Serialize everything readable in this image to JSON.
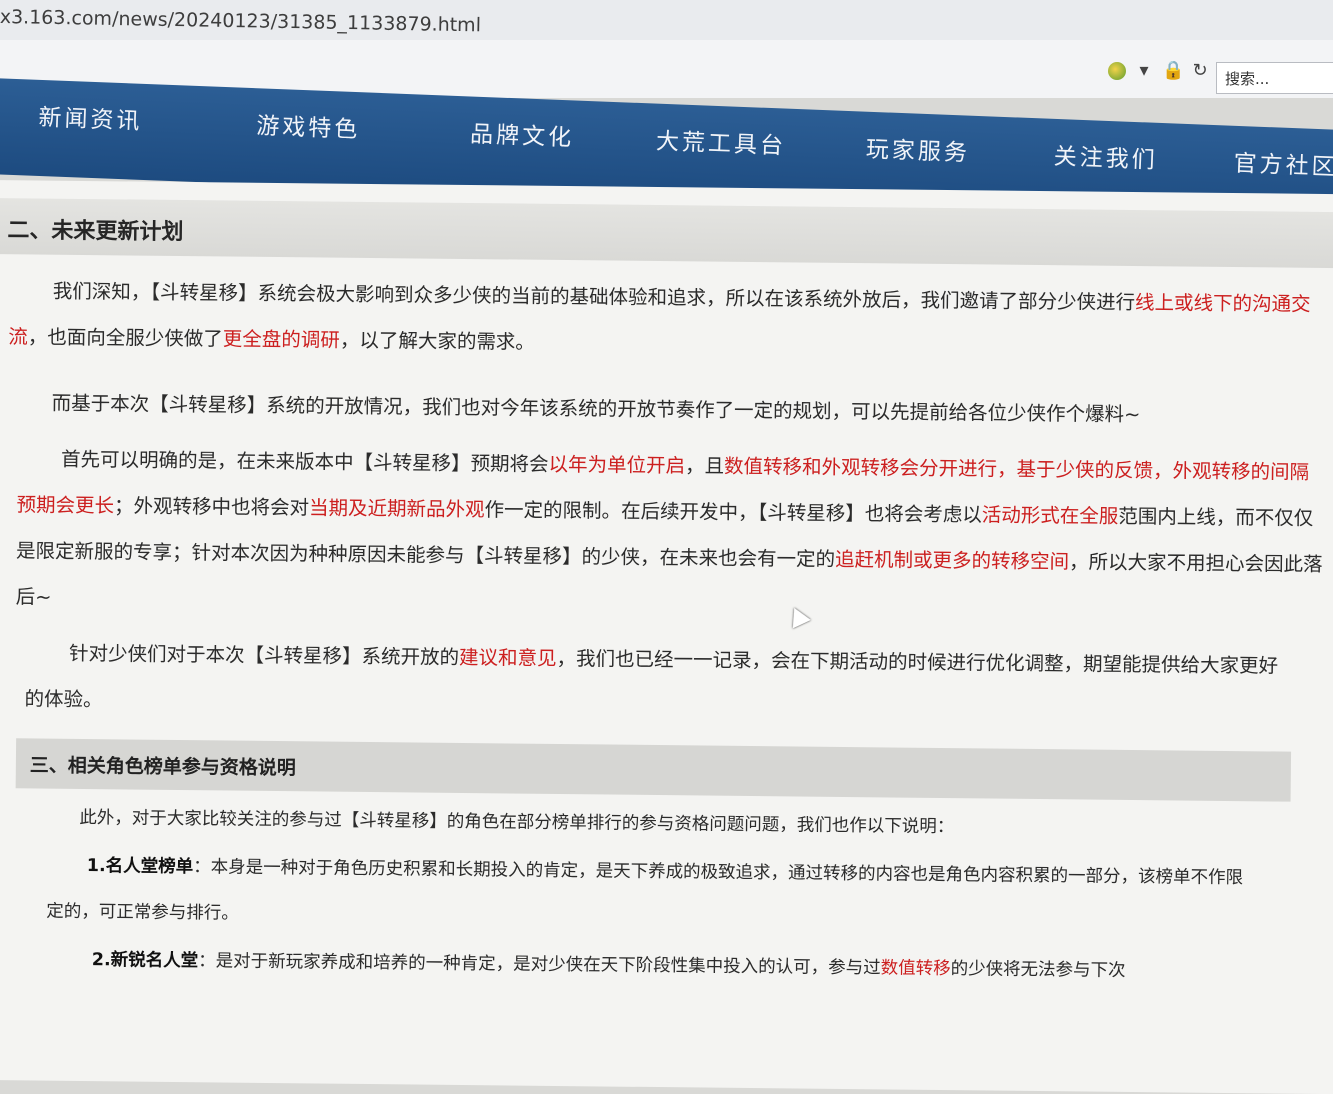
{
  "browser": {
    "url": "x3.163.com/news/20240123/31385_1133879.html",
    "search_placeholder": "搜索..."
  },
  "nav": {
    "items": [
      "新闻资讯",
      "游戏特色",
      "品牌文化",
      "大荒工具台",
      "玩家服务",
      "关注我们",
      "官方社区"
    ]
  },
  "section2": {
    "title": "二、未来更新计划",
    "p1": {
      "a": "我们深知，【斗转星移】系统会极大影响到众多少侠的当前的基础体验和追求，所以在该系统外放后，我们邀请了部分少侠进行",
      "r1": "线上或线下的沟通交流",
      "b": "，也面向全服少侠做了",
      "r2": "更全盘的调研",
      "c": "，以了解大家的需求。"
    },
    "p2": "而基于本次【斗转星移】系统的开放情况，我们也对今年该系统的开放节奏作了一定的规划，可以先提前给各位少侠作个爆料~",
    "p3": {
      "a": "首先可以明确的是，在未来版本中【斗转星移】预期将会",
      "r1": "以年为单位开启",
      "b": "，且",
      "r2": "数值转移和外观转移会分开进行，基于少侠的反馈，外观转移的间隔预期会更长",
      "c": "；外观转移中也将会对",
      "r3": "当期及近期新品外观",
      "d": "作一定的限制。在后续开发中，【斗转星移】也将会考虑以",
      "r4": "活动形式在全服",
      "e": "范围内上线，而不仅仅是限定新服的专享；针对本次因为种种原因未能参与【斗转星移】的少侠，在未来也会有一定的",
      "r5": "追赶机制或更多的转移空间",
      "f": "，所以大家不用担心会因此落后~"
    },
    "p4": {
      "a": "针对少侠们对于本次【斗转星移】系统开放的",
      "r1": "建议和意见",
      "b": "，我们也已经一一记录，会在下期活动的时候进行优化调整，期望能提供给大家更好的体验。"
    }
  },
  "section3": {
    "title": "三、相关角色榜单参与资格说明",
    "intro": "此外，对于大家比较关注的参与过【斗转星移】的角色在部分榜单排行的参与资格问题问题，我们也作以下说明：",
    "item1": {
      "label": "1.名人堂榜单",
      "text": "：本身是一种对于角色历史积累和长期投入的肯定，是天下养成的极致追求，通过转移的内容也是角色内容积累的一部分，该榜单不作限定的，可正常参与排行。"
    },
    "item2": {
      "label": "2.新锐名人堂",
      "a": "：是对于新玩家养成和培养的一种肯定，是对少侠在天下阶段性集中投入的认可，参与过",
      "r1": "数值转移",
      "b": "的少侠将无法参与下次"
    }
  },
  "colors": {
    "nav_bg": "#1d4b80",
    "highlight": "#cc1f1f"
  }
}
